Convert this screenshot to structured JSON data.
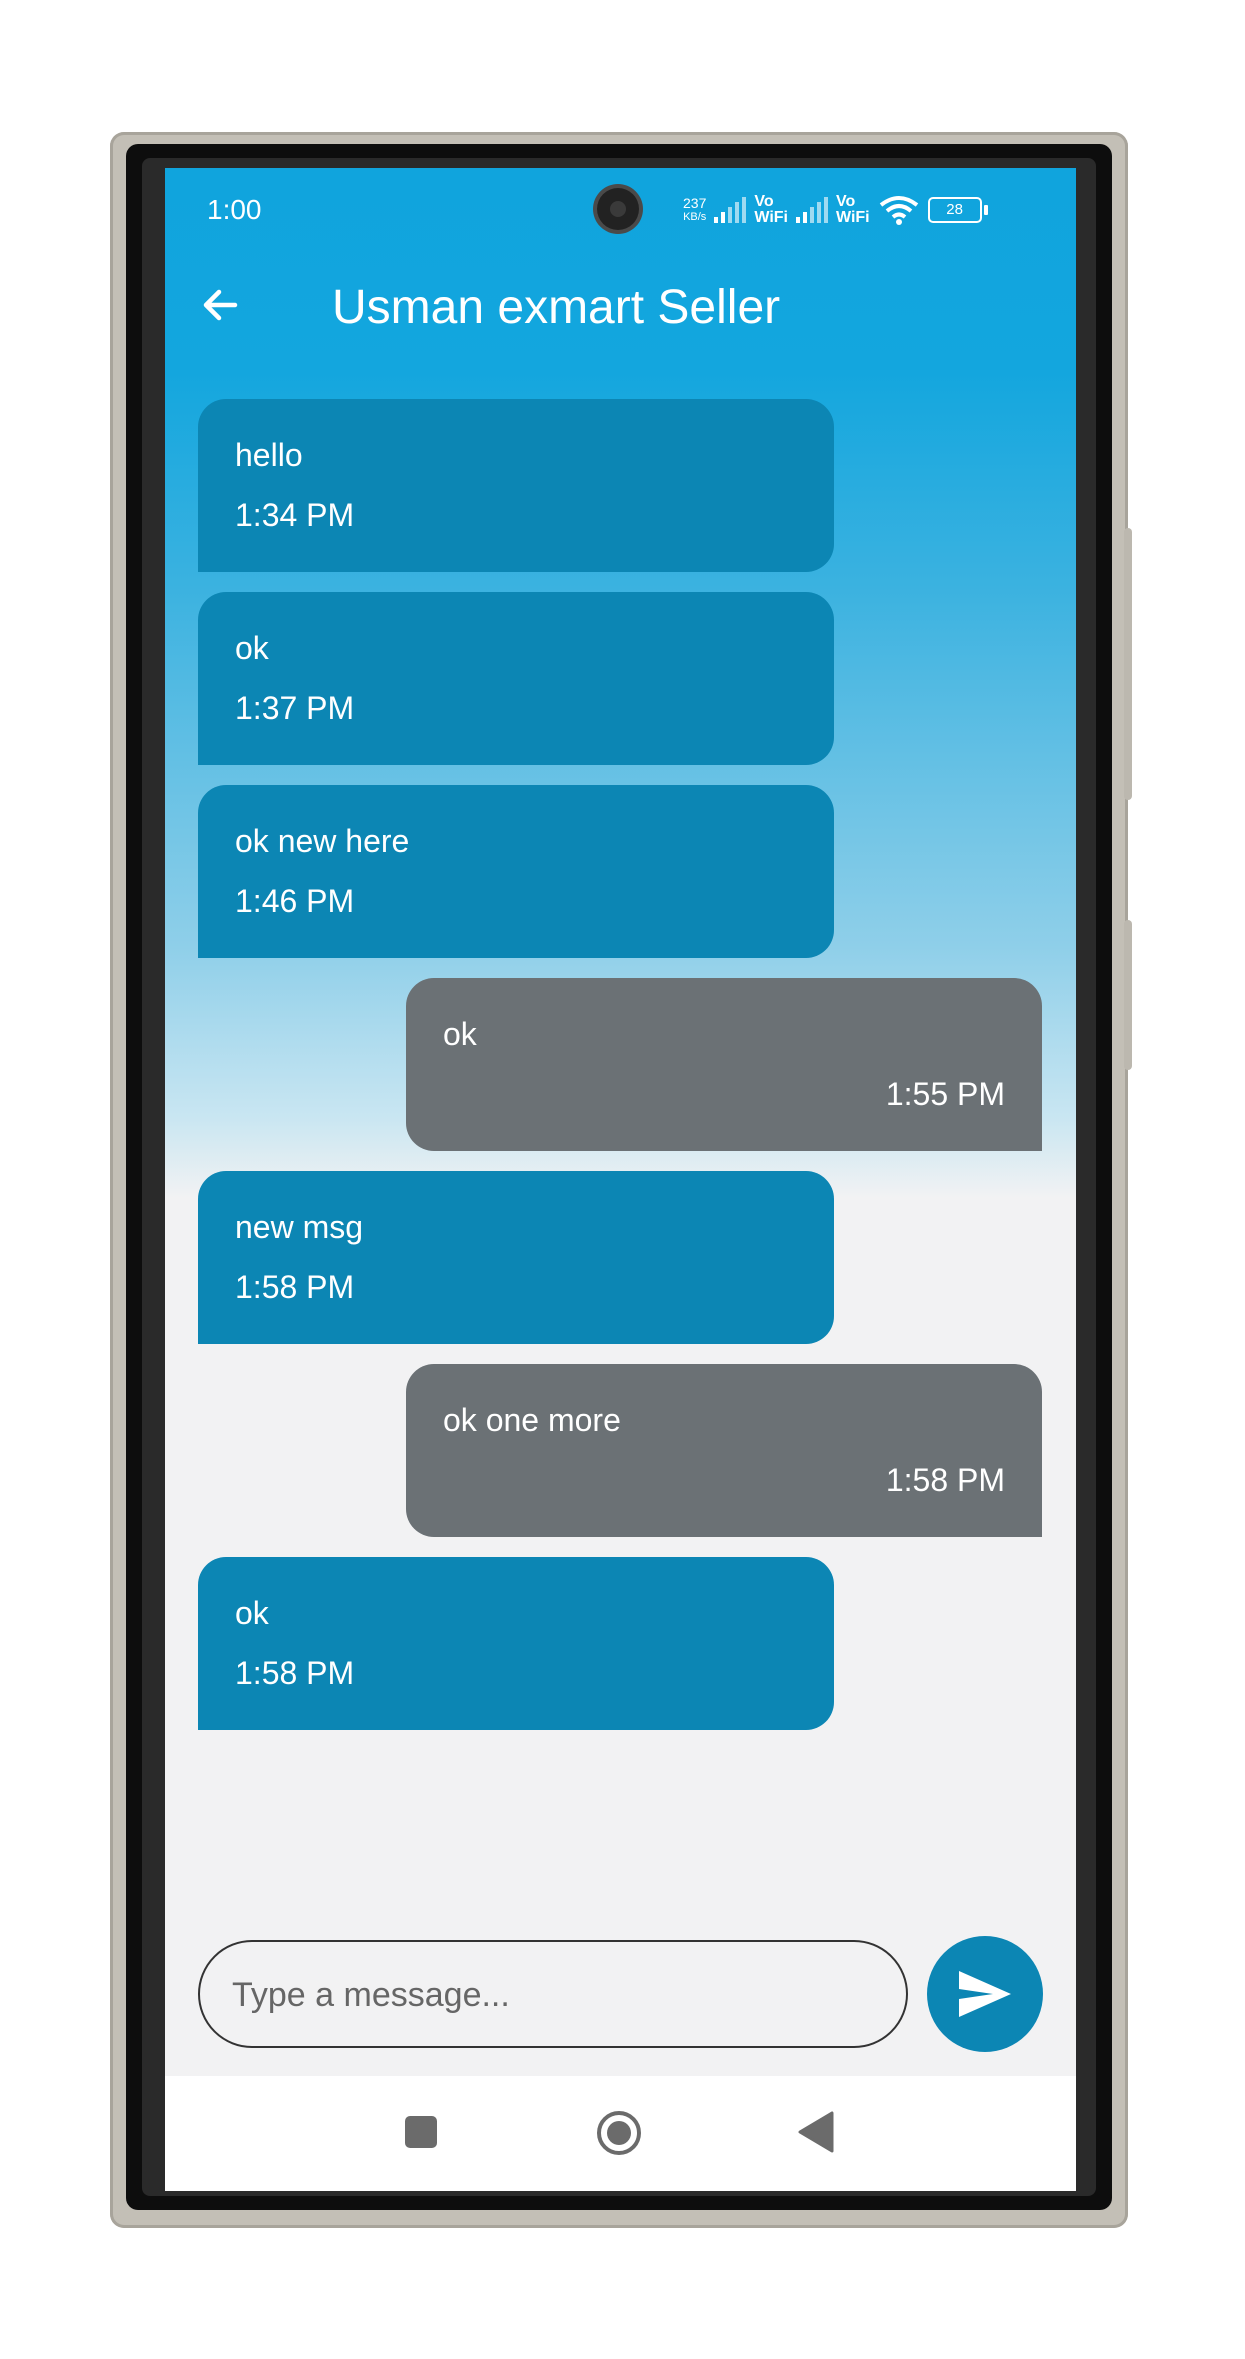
{
  "status_bar": {
    "time": "1:00",
    "net_speed_value": "237",
    "net_speed_unit": "KB/s",
    "vowifi_1": "Vo\nWiFi",
    "vowifi_2": "Vo\nWiFi",
    "battery": "28"
  },
  "header": {
    "title": "Usman exmart Seller"
  },
  "messages": [
    {
      "text": "hello",
      "time": "1:34 PM",
      "direction": "incoming"
    },
    {
      "text": "ok",
      "time": "1:37 PM",
      "direction": "incoming"
    },
    {
      "text": "ok new here",
      "time": "1:46 PM",
      "direction": "incoming"
    },
    {
      "text": "ok",
      "time": "1:55 PM",
      "direction": "outgoing"
    },
    {
      "text": "new msg",
      "time": "1:58 PM",
      "direction": "incoming"
    },
    {
      "text": "ok one more",
      "time": "1:58 PM",
      "direction": "outgoing"
    },
    {
      "text": "ok",
      "time": "1:58 PM",
      "direction": "incoming"
    }
  ],
  "composer": {
    "placeholder": "Type a message...",
    "value": ""
  },
  "icons": {
    "back": "arrow-left-icon",
    "send": "send-icon",
    "nav_recents": "square-icon",
    "nav_home": "circle-icon",
    "nav_back": "triangle-back-icon"
  },
  "colors": {
    "appbar": "#10a4dd",
    "incoming_bubble": "#0c86b4",
    "outgoing_bubble": "#6b7175",
    "send_button": "#0c86b4",
    "background": "#f2f2f3"
  }
}
